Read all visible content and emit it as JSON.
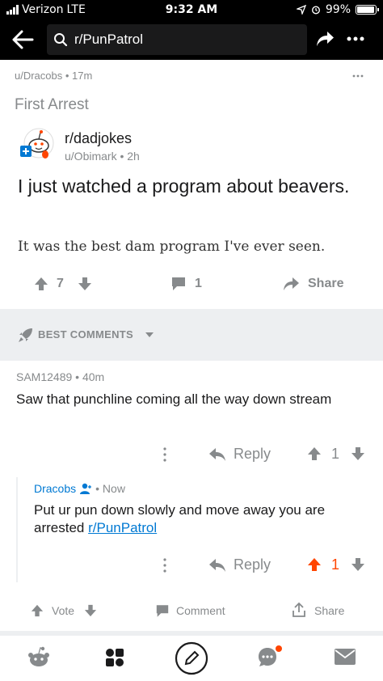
{
  "status_bar": {
    "carrier": "Verizon",
    "network": "LTE",
    "time": "9:32 AM",
    "battery": "99%"
  },
  "nav": {
    "search_text": "r/PunPatrol"
  },
  "post": {
    "author_meta": "u/Dracobs • 17m",
    "title": "First Arrest",
    "crosspost": {
      "subreddit": "r/dadjokes",
      "author_meta": "u/Obimark • 2h",
      "title": "I just watched a program about beavers.",
      "body": "It was the best dam program I've ever seen.",
      "score": "7",
      "comments": "1",
      "share_label": "Share"
    }
  },
  "comments_sort": {
    "label": "BEST COMMENTS"
  },
  "comments": [
    {
      "author_meta": "SAM12489 • 40m",
      "body": "Saw that punchline coming all the way down stream",
      "reply_label": "Reply",
      "score": "1"
    }
  ],
  "reply": {
    "author": "Dracobs",
    "time": "• Now",
    "body_prefix": "Put ur pun down slowly and move away you are arrested",
    "body_link": "r/PunPatrol",
    "reply_label": "Reply",
    "score": "1"
  },
  "post_bar": {
    "vote_label": "Vote",
    "comment_label": "Comment",
    "share_label": "Share"
  },
  "colors": {
    "upvote_active": "#ff4500",
    "link": "#0079d3",
    "muted": "#878a8c"
  }
}
